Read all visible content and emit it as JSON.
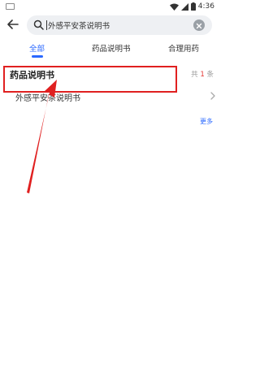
{
  "statusbar": {
    "time": "4:36"
  },
  "search": {
    "value": "外感平安茶说明书"
  },
  "tabs": [
    {
      "label": "全部",
      "active": true
    },
    {
      "label": "药品说明书",
      "active": false
    },
    {
      "label": "合理用药",
      "active": false
    }
  ],
  "section": {
    "title": "药品说明书",
    "count_prefix": "共",
    "count_num": "1",
    "count_suffix": "条"
  },
  "results": [
    {
      "title": "外感平安茶说明书"
    }
  ],
  "more_label": "更多",
  "colors": {
    "accent": "#2a68ff",
    "annotation": "#e02020",
    "count_highlight": "#e53935"
  }
}
